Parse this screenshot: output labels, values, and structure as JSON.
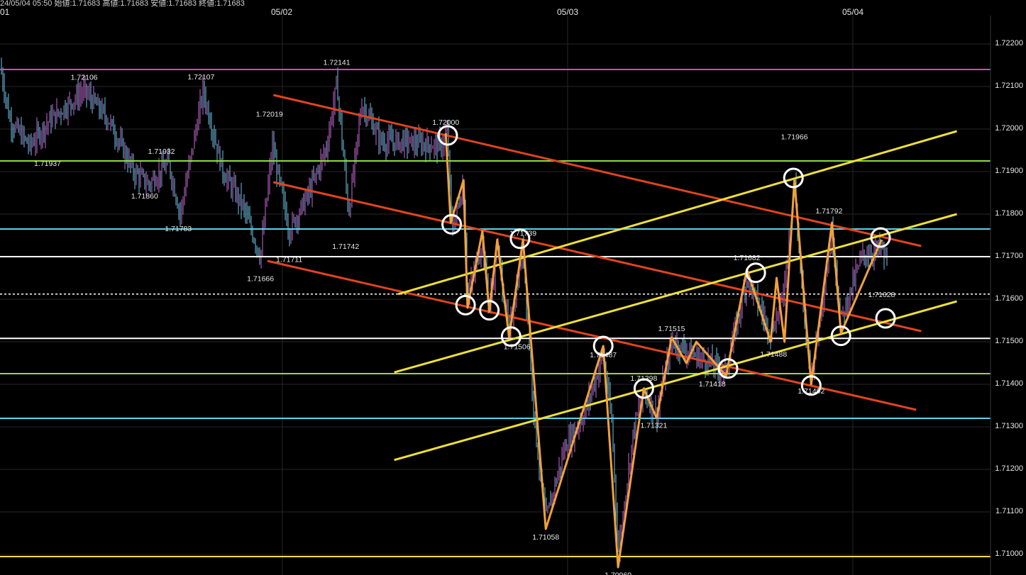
{
  "header": {
    "info": "24/05/04 05:50  始値:1.71683  高値:1.71683  安値:1.71683  終値:1.71683",
    "left_label": "01"
  },
  "colors": {
    "background": "#000000",
    "grid": "#262626",
    "candle_up": "#c86ad6",
    "candle_down": "#6fc6e8",
    "magenta_level": "#e0479e",
    "green_level": "#8fdd3a",
    "cyan_level": "#56d6e8",
    "white_level": "#ffffff",
    "yellow_level": "#f1e24a",
    "red_channel": "#e0441f",
    "yellow_channel": "#ecdf3a",
    "zigzag": "#f0a13a",
    "marker": "#ffffff"
  },
  "chart_data": {
    "type": "line",
    "title": "",
    "x_ticks": [
      "05/02",
      "05/03",
      "05/04"
    ],
    "y_ticks": [
      "1.72200",
      "1.72100",
      "1.72000",
      "1.71900",
      "1.71800",
      "1.71700",
      "1.71600",
      "1.71500",
      "1.71400",
      "1.71300",
      "1.71200",
      "1.71100",
      "1.71000"
    ],
    "ylim": [
      1.70955,
      1.72285
    ],
    "horizontal_levels": [
      {
        "price": 1.7214,
        "color": "magenta"
      },
      {
        "price": 1.71925,
        "color": "green"
      },
      {
        "price": 1.71765,
        "color": "cyan"
      },
      {
        "price": 1.717,
        "color": "white"
      },
      {
        "price": 1.71612,
        "color": "white",
        "dashed": true
      },
      {
        "price": 1.71508,
        "color": "white"
      },
      {
        "price": 1.71425,
        "color": "green"
      },
      {
        "price": 1.7132,
        "color": "cyan"
      },
      {
        "price": 1.70995,
        "color": "yellow"
      }
    ],
    "price_labels": [
      {
        "text": "1.72106",
        "x": 0.085,
        "price": 1.72106,
        "pos": "above"
      },
      {
        "text": "1.72107",
        "x": 0.203,
        "price": 1.72107,
        "pos": "above"
      },
      {
        "text": "1.72141",
        "x": 0.34,
        "price": 1.72141,
        "pos": "above"
      },
      {
        "text": "1.72019",
        "x": 0.272,
        "price": 1.72019,
        "pos": "above"
      },
      {
        "text": "1.71937",
        "x": 0.048,
        "price": 1.71937,
        "pos": "below"
      },
      {
        "text": "1.71932",
        "x": 0.163,
        "price": 1.71932,
        "pos": "above"
      },
      {
        "text": "1.71860",
        "x": 0.146,
        "price": 1.7186,
        "pos": "below"
      },
      {
        "text": "1.71783",
        "x": 0.18,
        "price": 1.71783,
        "pos": "below"
      },
      {
        "text": "1.71711",
        "x": 0.292,
        "price": 1.71711,
        "pos": "below"
      },
      {
        "text": "1.71666",
        "x": 0.263,
        "price": 1.71666,
        "pos": "below"
      },
      {
        "text": "1.71742",
        "x": 0.349,
        "price": 1.71742,
        "pos": "below"
      },
      {
        "text": "1.72000",
        "x": 0.45,
        "price": 1.72,
        "pos": "above"
      },
      {
        "text": "1.71739",
        "x": 0.528,
        "price": 1.71739,
        "pos": "above"
      },
      {
        "text": "1.71506",
        "x": 0.522,
        "price": 1.71506,
        "pos": "below"
      },
      {
        "text": "1.71487",
        "x": 0.609,
        "price": 1.71487,
        "pos": "below"
      },
      {
        "text": "1.71058",
        "x": 0.551,
        "price": 1.71058,
        "pos": "below"
      },
      {
        "text": "1.70969",
        "x": 0.624,
        "price": 1.70969,
        "pos": "below"
      },
      {
        "text": "1.71398",
        "x": 0.65,
        "price": 1.71398,
        "pos": "above"
      },
      {
        "text": "1.71321",
        "x": 0.66,
        "price": 1.71321,
        "pos": "below"
      },
      {
        "text": "1.71515",
        "x": 0.678,
        "price": 1.71515,
        "pos": "above"
      },
      {
        "text": "1.71418",
        "x": 0.719,
        "price": 1.71418,
        "pos": "below"
      },
      {
        "text": "1.71682",
        "x": 0.754,
        "price": 1.71682,
        "pos": "above"
      },
      {
        "text": "1.71488",
        "x": 0.781,
        "price": 1.71488,
        "pos": "below"
      },
      {
        "text": "1.71966",
        "x": 0.802,
        "price": 1.71966,
        "pos": "above"
      },
      {
        "text": "1.71792",
        "x": 0.837,
        "price": 1.71792,
        "pos": "above"
      },
      {
        "text": "1.71402",
        "x": 0.819,
        "price": 1.71402,
        "pos": "below"
      },
      {
        "text": "1.71628",
        "x": 0.89,
        "price": 1.71628,
        "pos": "below"
      }
    ],
    "zigzag": [
      {
        "x": 0.45,
        "price": 1.7199
      },
      {
        "x": 0.455,
        "price": 1.7178
      },
      {
        "x": 0.468,
        "price": 1.7188
      },
      {
        "x": 0.472,
        "price": 1.7158
      },
      {
        "x": 0.487,
        "price": 1.7176
      },
      {
        "x": 0.494,
        "price": 1.7157
      },
      {
        "x": 0.502,
        "price": 1.7174
      },
      {
        "x": 0.514,
        "price": 1.7151
      },
      {
        "x": 0.528,
        "price": 1.7174
      },
      {
        "x": 0.551,
        "price": 1.7106
      },
      {
        "x": 0.609,
        "price": 1.7149
      },
      {
        "x": 0.624,
        "price": 1.7097
      },
      {
        "x": 0.65,
        "price": 1.7139
      },
      {
        "x": 0.663,
        "price": 1.7132
      },
      {
        "x": 0.678,
        "price": 1.7151
      },
      {
        "x": 0.693,
        "price": 1.7145
      },
      {
        "x": 0.703,
        "price": 1.715
      },
      {
        "x": 0.733,
        "price": 1.7142
      },
      {
        "x": 0.754,
        "price": 1.7167
      },
      {
        "x": 0.778,
        "price": 1.715
      },
      {
        "x": 0.784,
        "price": 1.7165
      },
      {
        "x": 0.792,
        "price": 1.715
      },
      {
        "x": 0.802,
        "price": 1.7188
      },
      {
        "x": 0.819,
        "price": 1.714
      },
      {
        "x": 0.84,
        "price": 1.7178
      },
      {
        "x": 0.849,
        "price": 1.7152
      },
      {
        "x": 0.89,
        "price": 1.7174
      }
    ],
    "markers": [
      {
        "x": 0.452,
        "price": 1.71985
      },
      {
        "x": 0.456,
        "price": 1.71776
      },
      {
        "x": 0.47,
        "price": 1.71586
      },
      {
        "x": 0.494,
        "price": 1.71574
      },
      {
        "x": 0.516,
        "price": 1.71512
      },
      {
        "x": 0.525,
        "price": 1.71742
      },
      {
        "x": 0.609,
        "price": 1.7149
      },
      {
        "x": 0.65,
        "price": 1.7139
      },
      {
        "x": 0.735,
        "price": 1.71437
      },
      {
        "x": 0.763,
        "price": 1.71662
      },
      {
        "x": 0.801,
        "price": 1.71885
      },
      {
        "x": 0.819,
        "price": 1.71397
      },
      {
        "x": 0.849,
        "price": 1.71514
      },
      {
        "x": 0.889,
        "price": 1.71745
      },
      {
        "x": 0.894,
        "price": 1.71555
      }
    ],
    "channels": [
      {
        "color": "red",
        "x1": 0.276,
        "p1": 1.7208,
        "x2": 0.93,
        "p2": 1.71725
      },
      {
        "color": "red",
        "x1": 0.276,
        "p1": 1.71875,
        "x2": 0.93,
        "p2": 1.71525
      },
      {
        "color": "red",
        "x1": 0.27,
        "p1": 1.7169,
        "x2": 0.925,
        "p2": 1.7134
      },
      {
        "color": "yellow",
        "x1": 0.402,
        "p1": 1.71612,
        "x2": 0.966,
        "p2": 1.71995
      },
      {
        "color": "yellow",
        "x1": 0.398,
        "p1": 1.71428,
        "x2": 0.966,
        "p2": 1.718
      },
      {
        "color": "yellow",
        "x1": 0.398,
        "p1": 1.71222,
        "x2": 0.966,
        "p2": 1.71595
      }
    ]
  }
}
